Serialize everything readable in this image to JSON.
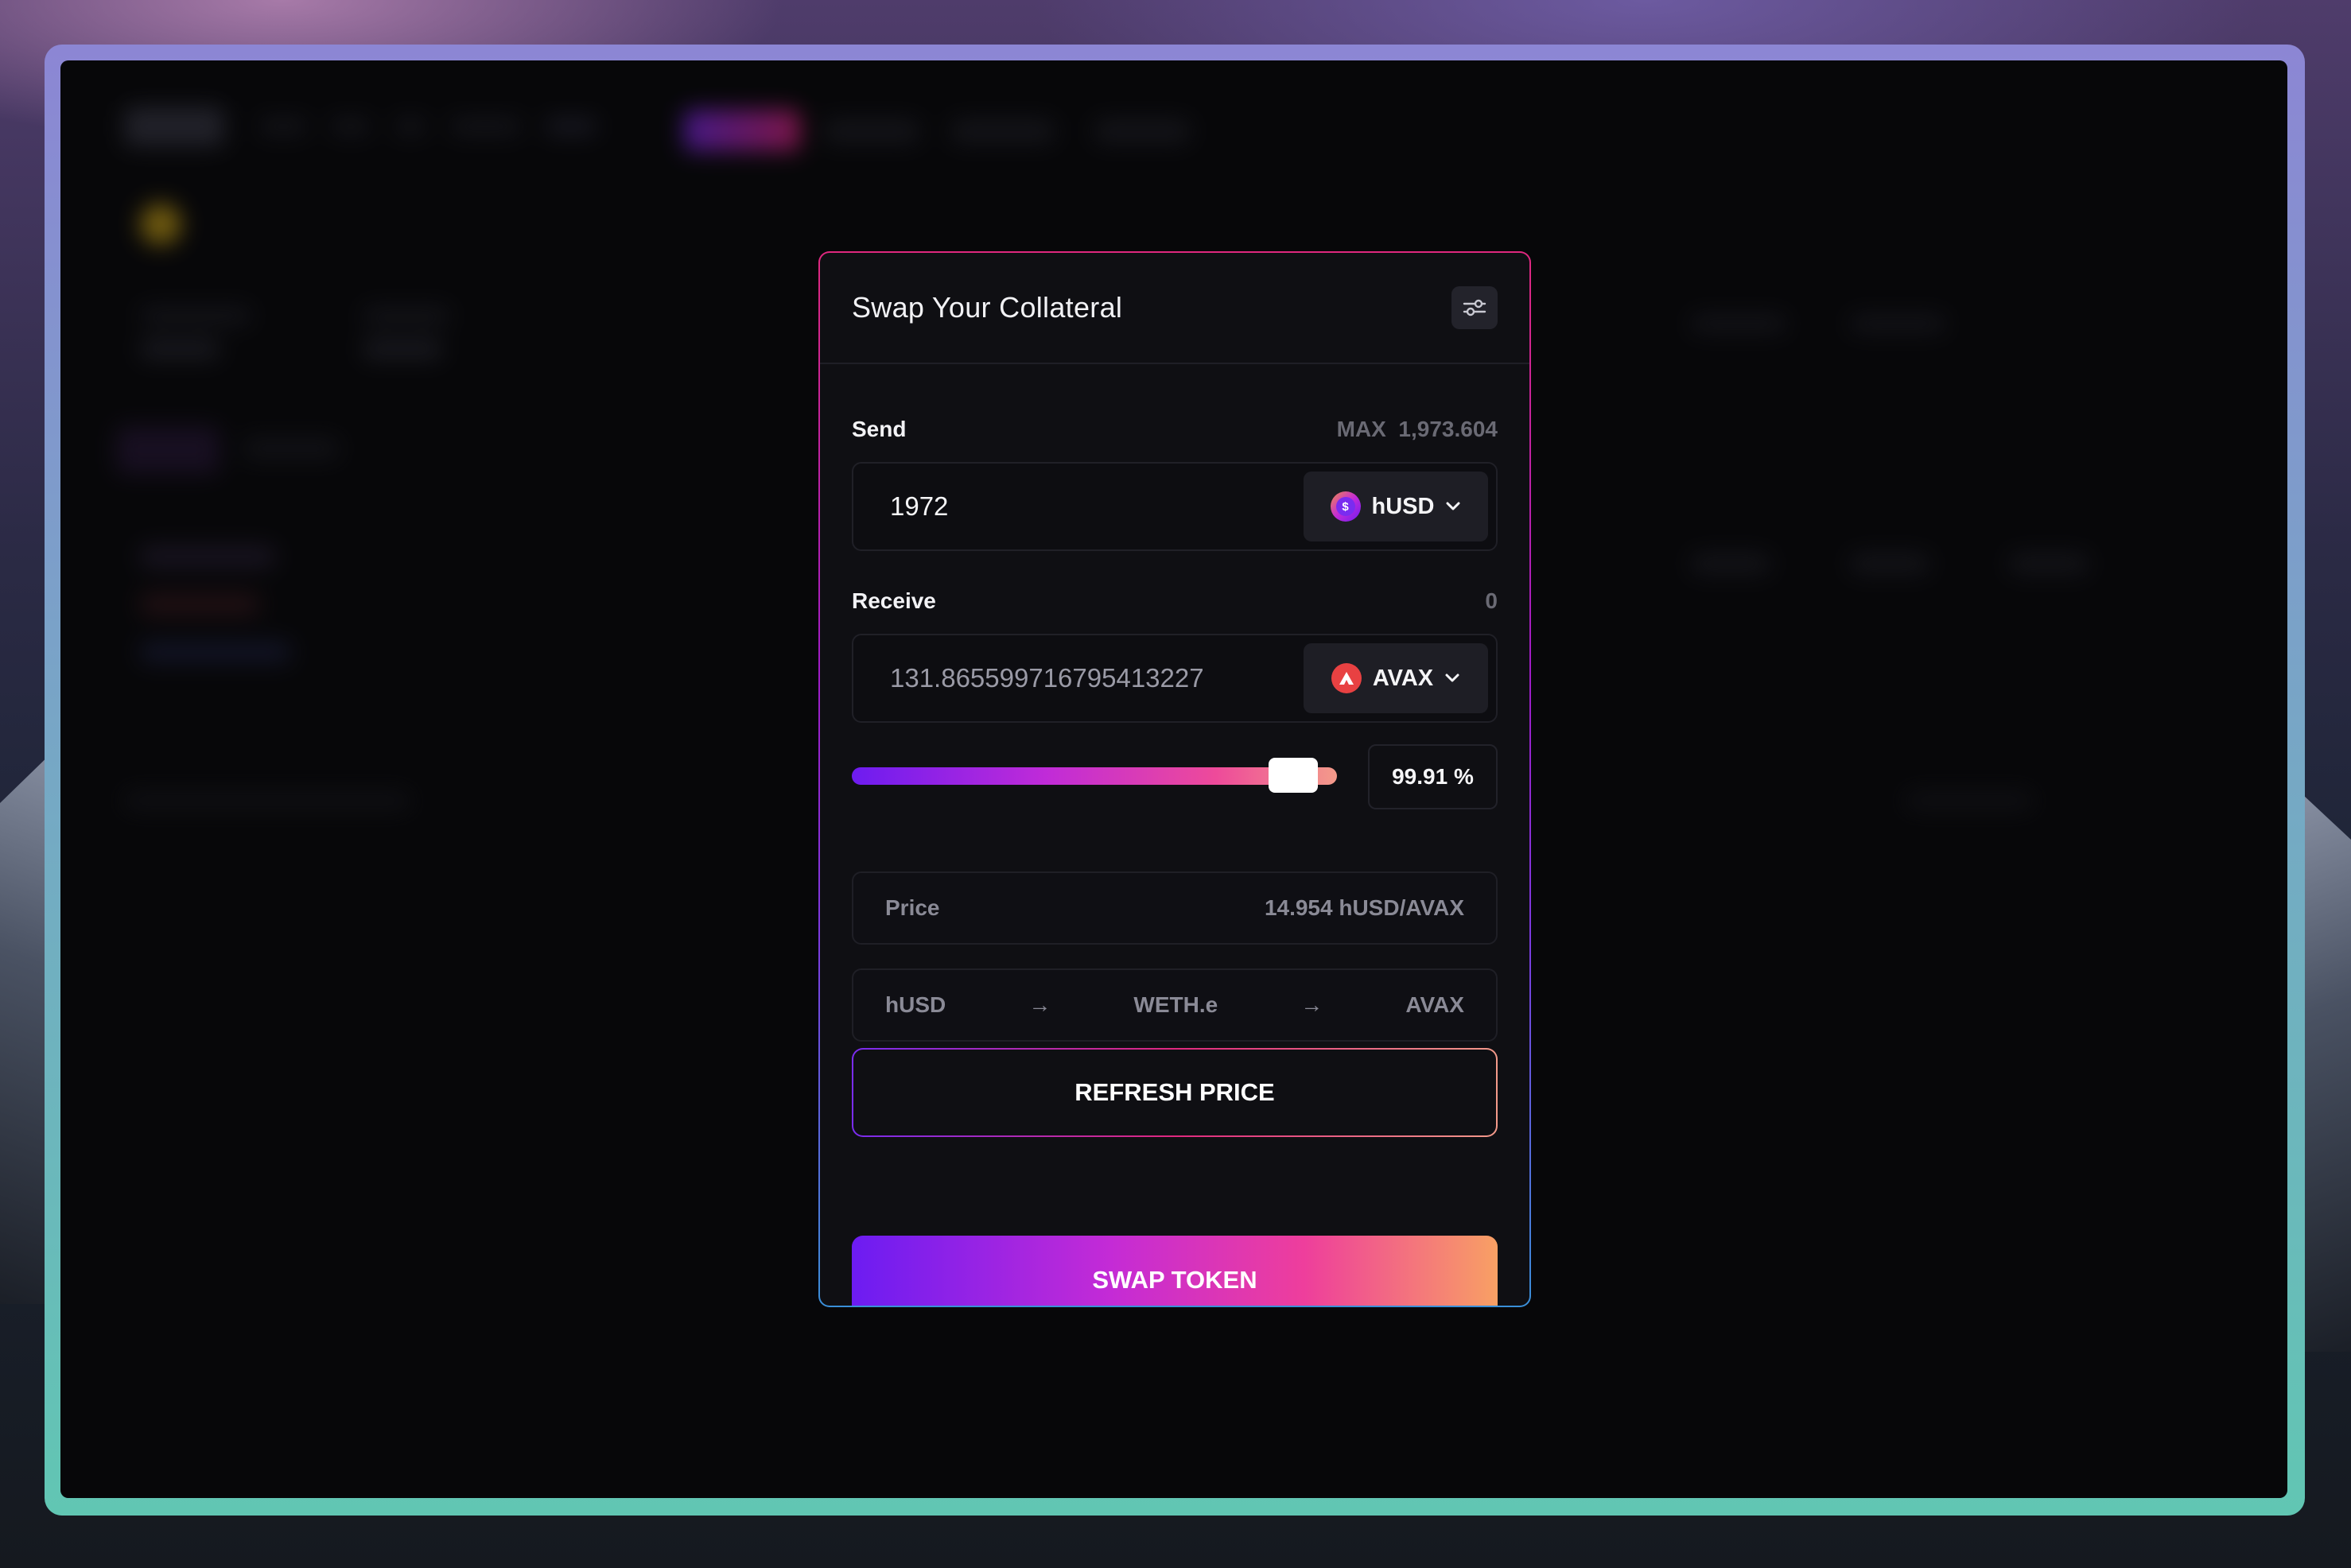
{
  "modal": {
    "title": "Swap Your Collateral",
    "settings_icon": "sliders-icon",
    "send": {
      "label": "Send",
      "max_label": "MAX",
      "max_value": "1,973.604",
      "amount": "1972",
      "token": "hUSD",
      "token_icon": "husd-coin-icon"
    },
    "receive": {
      "label": "Receive",
      "balance": "0",
      "amount": "131.865599716795413227",
      "token": "AVAX",
      "token_icon": "avax-icon"
    },
    "slider": {
      "percent_text": "99.91",
      "percent_symbol": "%",
      "value_percent": 99.91
    },
    "price": {
      "label": "Price",
      "value": "14.954 hUSD/AVAX"
    },
    "route": {
      "steps": [
        "hUSD",
        "WETH.e",
        "AVAX"
      ],
      "arrow": "→"
    },
    "refresh_label": "REFRESH PRICE",
    "swap_label": "SWAP TOKEN"
  },
  "colors": {
    "accent_start": "#6c1cf2",
    "accent_mid": "#ee3e9c",
    "accent_end": "#f8a064",
    "avax_red": "#e84142",
    "panel_bg": "#0f0f13"
  }
}
